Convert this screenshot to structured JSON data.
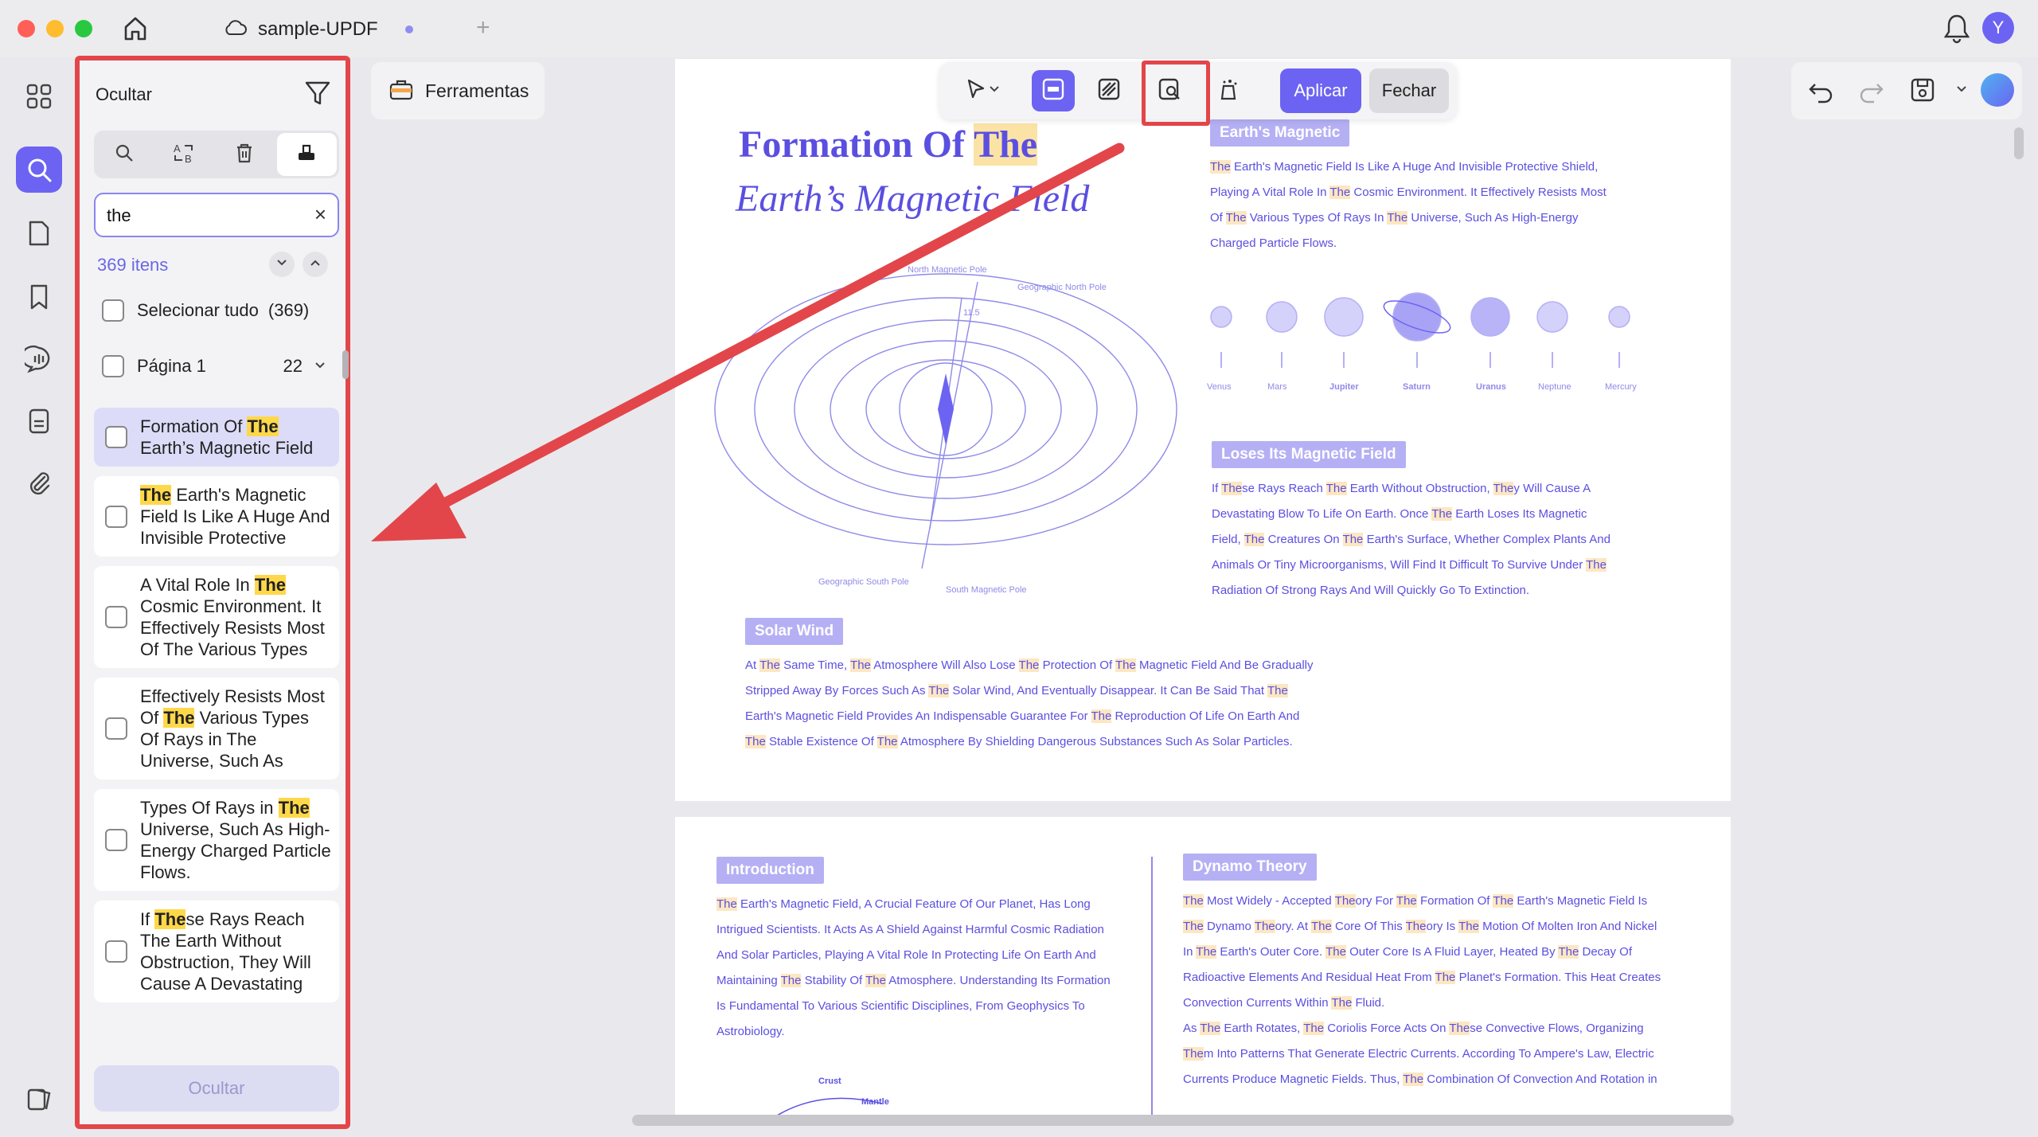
{
  "window": {
    "tab_title": "sample-UPDF",
    "avatar_letter": "Y"
  },
  "panel": {
    "title": "Ocultar",
    "search_value": "the",
    "count_label": "369 itens",
    "select_all_label": "Selecionar tudo",
    "select_all_count": "(369)",
    "page_label": "Página 1",
    "page_count": "22",
    "hide_button": "Ocultar",
    "results": [
      {
        "parts": [
          [
            "Formation Of ",
            false
          ],
          [
            "The",
            true
          ],
          [
            " Earth’s Magnetic Field",
            false
          ]
        ],
        "selected": true
      },
      {
        "parts": [
          [
            "The",
            true
          ],
          [
            " Earth's Magnetic Field Is Like A Huge And Invisible Protective",
            false
          ]
        ],
        "selected": false
      },
      {
        "parts": [
          [
            "A Vital Role In ",
            false
          ],
          [
            "The",
            true
          ],
          [
            " Cosmic Environment. It Effectively Resists Most Of The Various Types",
            false
          ]
        ],
        "selected": false
      },
      {
        "parts": [
          [
            "Effectively Resists Most Of ",
            false
          ],
          [
            "The",
            true
          ],
          [
            " Various Types Of Rays in The Universe, Such As",
            false
          ]
        ],
        "selected": false
      },
      {
        "parts": [
          [
            "Types Of Rays in ",
            false
          ],
          [
            "The",
            true
          ],
          [
            " Universe, Such As High-Energy Charged Particle Flows.",
            false
          ]
        ],
        "selected": false
      },
      {
        "parts": [
          [
            "If ",
            false
          ],
          [
            "The",
            true
          ],
          [
            "se Rays Reach The Earth Without Obstruction, They Will Cause A Devastating",
            false
          ]
        ],
        "selected": false
      }
    ]
  },
  "toolbar": {
    "tools_label": "Ferramentas",
    "apply_label": "Aplicar",
    "close_label": "Fechar"
  },
  "document": {
    "title_line1_pre": "Formation Of ",
    "title_line1_hl": "The",
    "title_line2": "Earth’s Magnetic Field",
    "diagram_labels": {
      "north_magnetic": "North Magnetic Pole",
      "geo_north": "Geographic North Pole",
      "geo_south": "Geographic South Pole",
      "south_magnetic": "South Magnetic Pole",
      "angle": "11.5"
    },
    "tag_earth": "Earth's Magnetic",
    "earth_para": [
      "The Earth's Magnetic Field Is Like A Huge And Invisible Protective Shield,",
      "Playing A Vital Role In The Cosmic Environment. It Effectively Resists Most",
      "Of The Various Types Of Rays In The Universe, Such As High-Energy",
      "Charged Particle Flows."
    ],
    "planets": [
      "Venus",
      "Mars",
      "Jupiter",
      "Saturn",
      "Uranus",
      "Neptune",
      "Mercury"
    ],
    "tag_loses": "Loses Its Magnetic Field",
    "loses_para": [
      "If These Rays Reach The Earth Without Obstruction, They Will Cause A",
      "Devastating Blow To Life On Earth. Once The Earth Loses Its Magnetic",
      "Field, The Creatures On The Earth's Surface, Whether Complex Plants And",
      "Animals Or Tiny Microorganisms, Will Find It Difficult To Survive Under The",
      "Radiation Of Strong Rays And Will Quickly Go To Extinction."
    ],
    "tag_solar": "Solar Wind",
    "solar_para": [
      "At The Same Time, The Atmosphere Will Also Lose The Protection Of The Magnetic Field And Be Gradually",
      "Stripped Away By Forces Such As The Solar Wind, And Eventually Disappear. It Can Be Said That The",
      "Earth's Magnetic Field Provides An Indispensable Guarantee For The Reproduction Of Life On Earth And",
      "The Stable Existence Of The Atmosphere By Shielding Dangerous Substances Such As Solar Particles."
    ],
    "tag_intro": "Introduction",
    "intro_para": [
      "The Earth's Magnetic Field, A Crucial Feature Of Our Planet, Has Long",
      "Intrigued Scientists. It Acts As A Shield Against Harmful Cosmic Radiation",
      "And Solar Particles, Playing A Vital Role In Protecting Life On Earth And",
      "Maintaining The Stability Of The Atmosphere. Understanding Its Formation",
      "Is Fundamental To Various Scientific Disciplines, From Geophysics To",
      "Astrobiology."
    ],
    "tag_dynamo": "Dynamo Theory",
    "dynamo_para": [
      "The Most Widely - Accepted Theory For The Formation Of The Earth's Magnetic Field Is",
      "The Dynamo Theory. At The Core Of This Theory Is The Motion Of Molten Iron And Nickel",
      "In The Earth's Outer Core. The Outer Core Is A Fluid Layer, Heated By The Decay Of",
      "Radioactive Elements And Residual Heat From The Planet's Formation. This Heat Creates",
      "Convection Currents Within The Fluid.",
      "As The Earth Rotates, The Coriolis Force Acts On These Convective Flows, Organizing",
      "Them Into Patterns That Generate Electric Currents. According To Ampere's Law, Electric",
      "Currents Produce Magnetic Fields. Thus, The Combination Of Convection And Rotation in"
    ],
    "crust_label": "Crust",
    "mantle_label": "Mantle"
  },
  "colors": {
    "accent": "#6c63f2",
    "highlight": "#ffd84a",
    "annotation_red": "#e2464a",
    "doc_text": "#5b4fe0"
  }
}
